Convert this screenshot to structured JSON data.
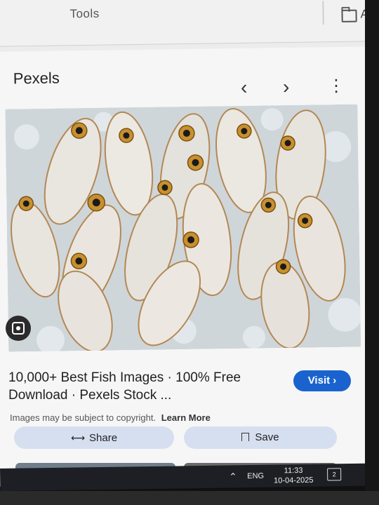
{
  "toolbar": {
    "tools_label": "Tools",
    "all_label": "All"
  },
  "viewer": {
    "source_name": "Pexels",
    "prev_icon": "chevron-left-icon",
    "next_icon": "chevron-right-icon",
    "more_icon": "more-vert-icon",
    "close_icon": "close-icon",
    "lens_icon": "google-lens-icon"
  },
  "result": {
    "title_line1": "10,000+ Best Fish Images · 100% Free",
    "title_line2": "Download · Pexels Stock ...",
    "visit_label": "Visit",
    "copyright_text": "Images may be subject to copyright.",
    "learn_more_label": "Learn More",
    "share_label": "Share",
    "save_label": "Save"
  },
  "taskbar": {
    "lang": "ENG",
    "time": "11:33",
    "date": "10-04-2025",
    "notifications": "2"
  },
  "colors": {
    "visit_button": "#1a63cf",
    "pill_buttons": "#d6dff0",
    "taskbar": "#1d1f24"
  }
}
